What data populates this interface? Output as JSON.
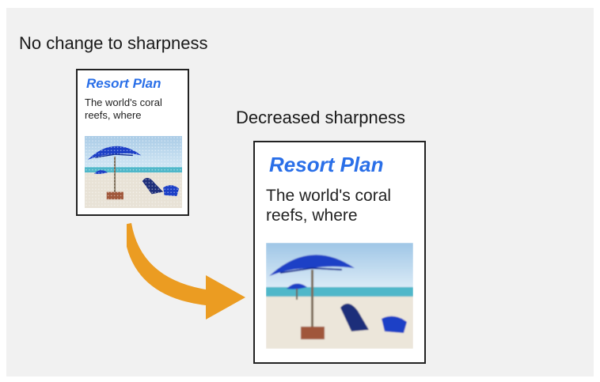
{
  "labels": {
    "before": "No change to sharpness",
    "after": "Decreased sharpness"
  },
  "document_before": {
    "title": "Resort Plan",
    "body": "The world's coral reefs, where",
    "image_icon": "beach-umbrella-photo"
  },
  "document_after": {
    "title": "Resort Plan",
    "body": "The world's coral reefs, where",
    "image_icon": "beach-umbrella-photo"
  },
  "colors": {
    "panel_background": "#f1f1f1",
    "title_blue": "#2a6fe8",
    "arrow_orange": "#eb9c22",
    "umbrella_blue": "#1c3fc6"
  }
}
